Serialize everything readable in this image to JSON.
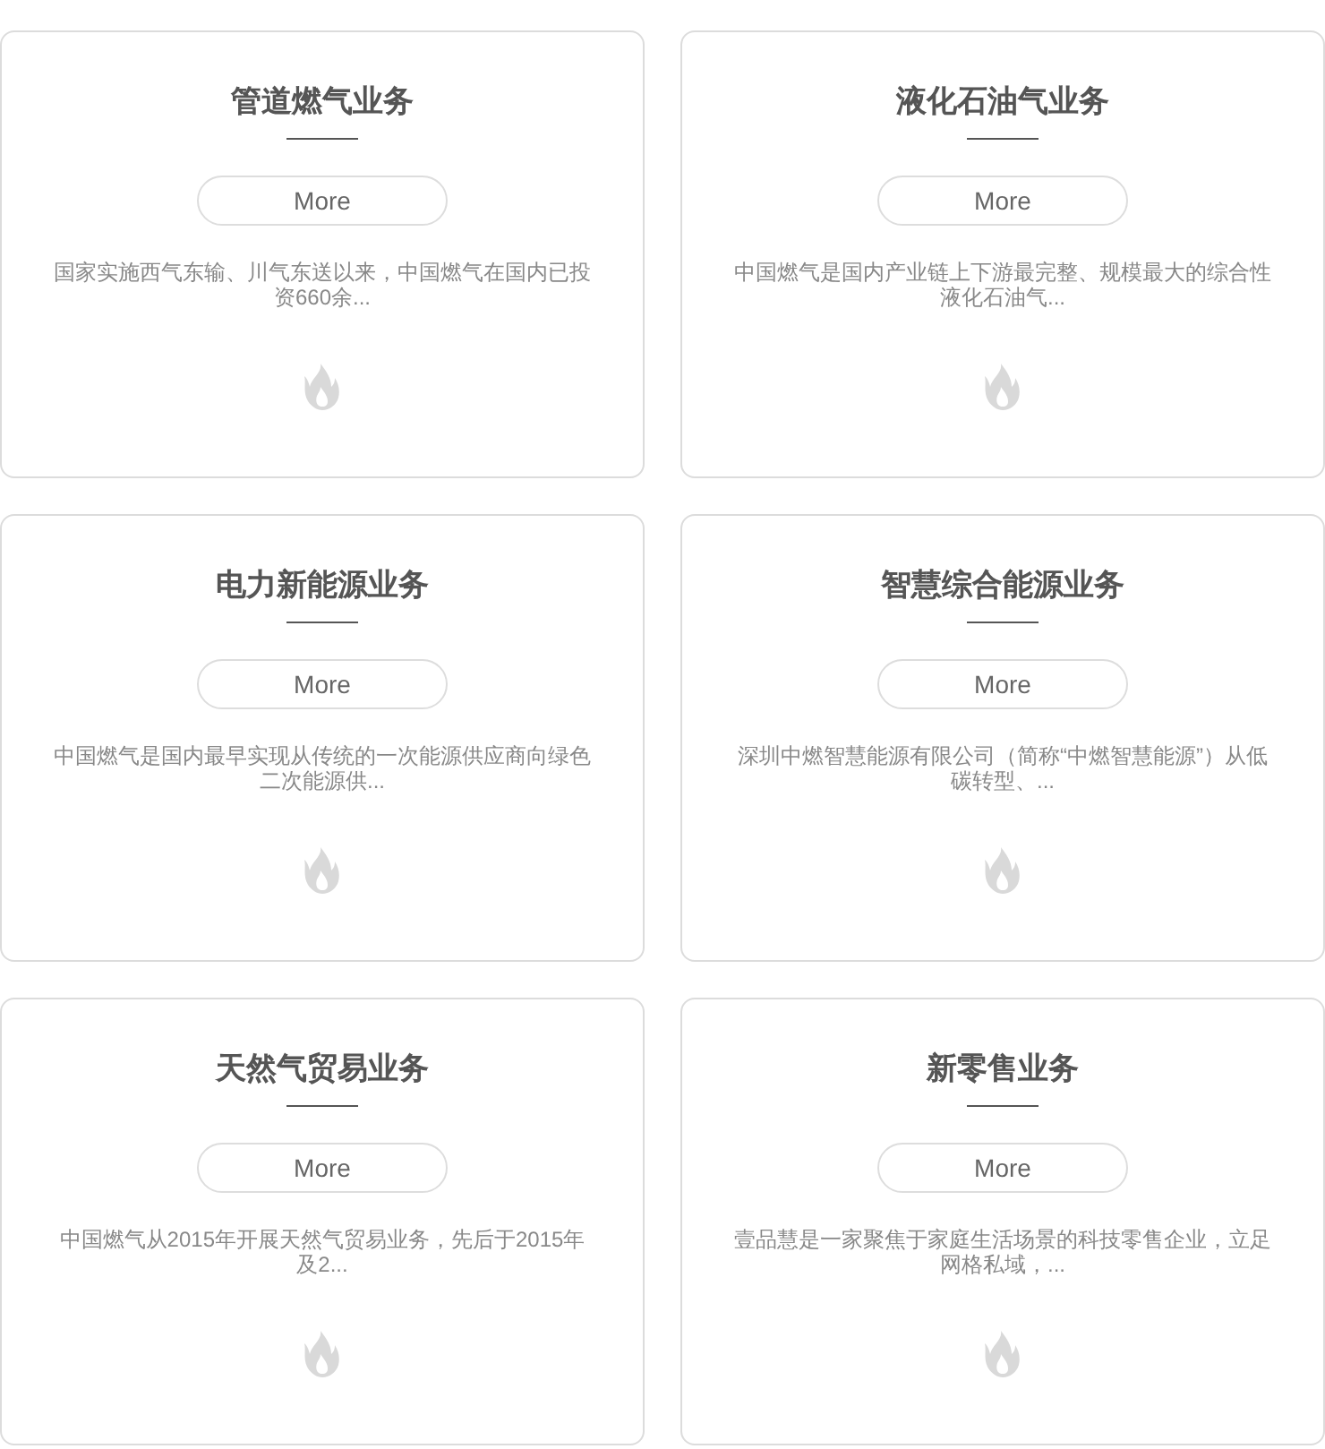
{
  "cards": [
    {
      "title": "管道燃气业务",
      "button": "More",
      "description": "国家实施西气东输、川气东送以来，中国燃气在国内已投资660余..."
    },
    {
      "title": "液化石油气业务",
      "button": "More",
      "description": "中国燃气是国内产业链上下游最完整、规模最大的综合性液化石油气..."
    },
    {
      "title": "电力新能源业务",
      "button": "More",
      "description": "中国燃气是国内最早实现从传统的一次能源供应商向绿色二次能源供..."
    },
    {
      "title": "智慧综合能源业务",
      "button": "More",
      "description": "深圳中燃智慧能源有限公司（简称“中燃智慧能源”）从低碳转型、..."
    },
    {
      "title": "天然气贸易业务",
      "button": "More",
      "description": "中国燃气从2015年开展天然气贸易业务，先后于2015年及2..."
    },
    {
      "title": "新零售业务",
      "button": "More",
      "description": "壹品慧是一家聚焦于家庭生活场景的科技零售企业，立足网格私域，..."
    }
  ]
}
